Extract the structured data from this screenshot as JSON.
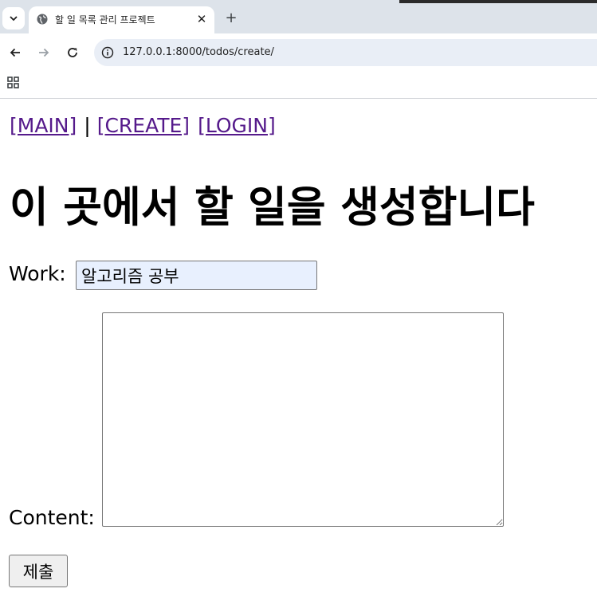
{
  "browser": {
    "tab_title": "할 일 목록 관리 프로젝트",
    "tab_close_glyph": "✕",
    "new_tab_glyph": "+",
    "url": "127.0.0.1:8000/todos/create/",
    "icons": [
      "tab-search-icon",
      "globe-icon",
      "close-icon",
      "plus-icon",
      "back-arrow-icon",
      "forward-arrow-icon",
      "reload-icon",
      "site-info-icon",
      "apps-grid-icon"
    ]
  },
  "nav": {
    "main": "[MAIN]",
    "separator": "|",
    "create": "[CREATE]",
    "login": "[LOGIN]"
  },
  "page": {
    "heading": "이 곳에서 할 일을 생성합니다",
    "work_label": "Work:",
    "work_value": "알고리즘 공부",
    "content_label": "Content:",
    "content_value": "",
    "submit_label": "제출"
  },
  "colors": {
    "link_visited": "#551a8b",
    "chrome_frame": "#dde3ea",
    "omnibox": "#e9eef6",
    "autofill_bg": "#e8f0fe"
  }
}
